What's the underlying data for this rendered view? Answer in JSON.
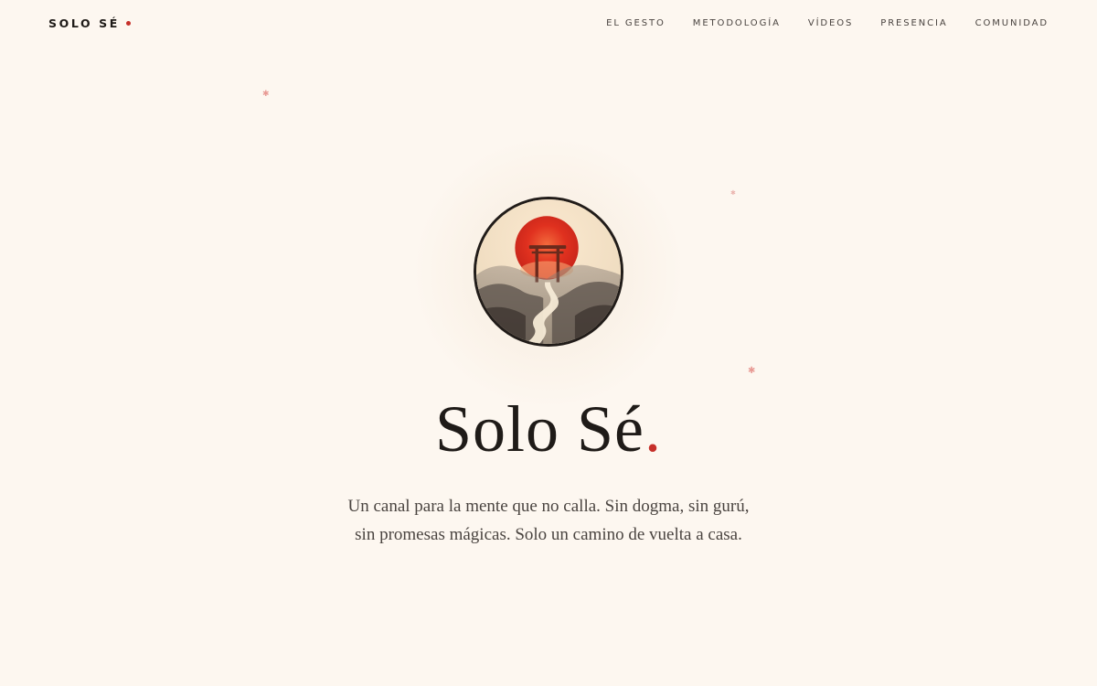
{
  "brand": {
    "name": "SOLO SÉ",
    "dot_color": "#c6302a"
  },
  "nav": {
    "items": [
      {
        "label": "EL GESTO"
      },
      {
        "label": "METODOLOGÍA"
      },
      {
        "label": "VÍDEOS"
      },
      {
        "label": "PRESENCIA"
      },
      {
        "label": "COMUNIDAD"
      }
    ]
  },
  "hero": {
    "logo_icon": "torii-gate-sunset-logo",
    "title": "Solo Sé",
    "title_dot": ".",
    "subtitle_line1": "Un canal para la mente que no calla. Sin dogma, sin gurú,",
    "subtitle_line2": "sin promesas mágicas. Solo un camino de vuelta a casa."
  },
  "colors": {
    "background": "#fdf7f0",
    "accent": "#c6302a",
    "text": "#1f1b18",
    "muted_text": "#4a4440"
  }
}
